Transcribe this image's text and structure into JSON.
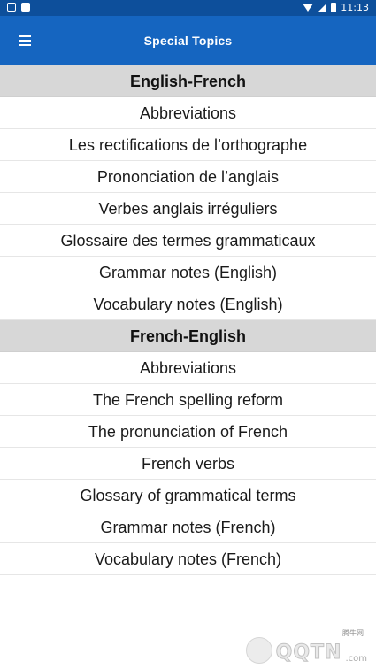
{
  "status_bar": {
    "time": "11:13"
  },
  "app_bar": {
    "title": "Special Topics",
    "menu_icon": "hamburger-menu-icon"
  },
  "sections": [
    {
      "header": "English-French",
      "items": [
        "Abbreviations",
        "Les rectifications de l’orthographe",
        "Prononciation de l’anglais",
        "Verbes anglais irréguliers",
        "Glossaire des termes grammaticaux",
        "Grammar notes (English)",
        "Vocabulary notes (English)"
      ]
    },
    {
      "header": "French-English",
      "items": [
        "Abbreviations",
        "The French spelling reform",
        "The pronunciation of French",
        "French verbs",
        "Glossary of grammatical terms",
        "Grammar notes (French)",
        "Vocabulary notes (French)"
      ]
    }
  ],
  "watermark": {
    "text": "QQTN",
    "suffix": ".com",
    "small": "腾牛网"
  },
  "colors": {
    "status_bar": "#0d4f9b",
    "app_bar": "#1565c0",
    "section_header_bg": "#d7d7d7"
  }
}
